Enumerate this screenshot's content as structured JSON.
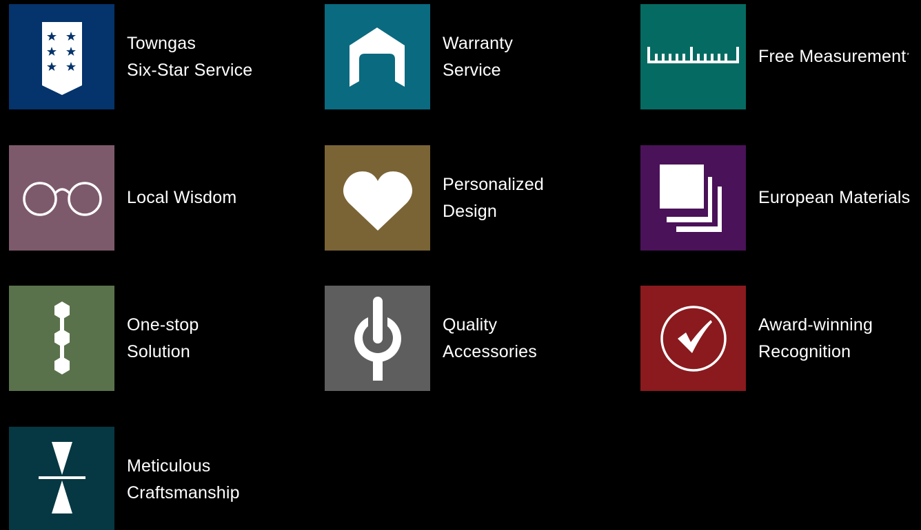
{
  "features": [
    {
      "id": "towngas",
      "lines": [
        "Towngas",
        "Six-Star Service"
      ],
      "color": "#05336b",
      "icon": "shield-stars-icon"
    },
    {
      "id": "warranty",
      "lines": [
        "Warranty",
        "Service"
      ],
      "color": "#0a6a80",
      "icon": "house-icon"
    },
    {
      "id": "measurement",
      "lines": [
        "Free Measurement"
      ],
      "sup": "*",
      "color": "#056b62",
      "icon": "ruler-icon"
    },
    {
      "id": "local-wisdom",
      "lines": [
        "Local Wisdom"
      ],
      "color": "#7d5a6b",
      "icon": "glasses-icon"
    },
    {
      "id": "personalized",
      "lines": [
        "Personalized",
        "Design"
      ],
      "color": "#7a6436",
      "icon": "heart-icon"
    },
    {
      "id": "european",
      "lines": [
        "European Materials"
      ],
      "color": "#4a1258",
      "icon": "stacked-squares-icon"
    },
    {
      "id": "one-stop",
      "lines": [
        "One-stop",
        "Solution"
      ],
      "color": "#5a724b",
      "icon": "hexagon-chain-icon"
    },
    {
      "id": "quality",
      "lines": [
        "Quality",
        "Accessories"
      ],
      "color": "#5e5e5e",
      "icon": "knob-icon"
    },
    {
      "id": "award",
      "lines": [
        "Award-winning",
        "Recognition"
      ],
      "color": "#8a1a1e",
      "icon": "checkmark-circle-icon"
    },
    {
      "id": "craftsmanship",
      "lines": [
        "Meticulous",
        "Craftsmanship"
      ],
      "color": "#053842",
      "icon": "caliper-icon"
    }
  ]
}
